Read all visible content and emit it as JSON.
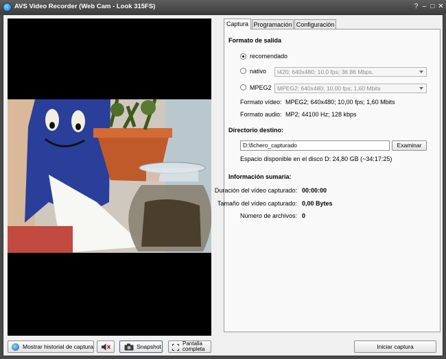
{
  "window": {
    "title": "AVS Video Recorder (Web Cam - Look 315FS)",
    "help": "?",
    "minimize": "–",
    "maximize": "□",
    "close": "✕"
  },
  "tabs": [
    {
      "label": "Captura",
      "active": true
    },
    {
      "label": "Programación",
      "active": false
    },
    {
      "label": "Configuración",
      "active": false
    }
  ],
  "output_format": {
    "heading": "Formato de salida",
    "options": [
      {
        "label": "recomendado",
        "selected": true,
        "combo": ""
      },
      {
        "label": "nativo",
        "selected": false,
        "combo": "I420; 640x480; 10.0 fps; 36.86 Mbps."
      },
      {
        "label": "MPEG2",
        "selected": false,
        "combo": "MPEG2; 640x480; 10,00 fps; 1,60 Mbits"
      }
    ],
    "video_label": "Formato vídeo:",
    "video_value": "MPEG2; 640x480; 10,00 fps; 1,60 Mbits",
    "audio_label": "Formato audio:",
    "audio_value": "MP2; 44100 Hz; 128 kbps"
  },
  "destination": {
    "heading": "Directorio destino:",
    "path": "D:\\fichero_capturado",
    "browse_label": "Examinar",
    "space_text": "Espacio disponible en el disco D: 24,80 GB (~34:17:25)"
  },
  "summary": {
    "heading": "Información sumaria:",
    "rows": [
      {
        "label": "Duración del vídeo capturado:",
        "value": "00:00:00"
      },
      {
        "label": "Tamaño del vídeo capturado:",
        "value": "0,00 Bytes"
      },
      {
        "label": "Número de archivos:",
        "value": "0"
      }
    ]
  },
  "bottom_bar": {
    "history_label": "Mostrar historial de captura",
    "snapshot_label": "Snapshot",
    "fullscreen_label_1": "Pantalla",
    "fullscreen_label_2": "completa",
    "start_label": "Iniciar captura"
  }
}
